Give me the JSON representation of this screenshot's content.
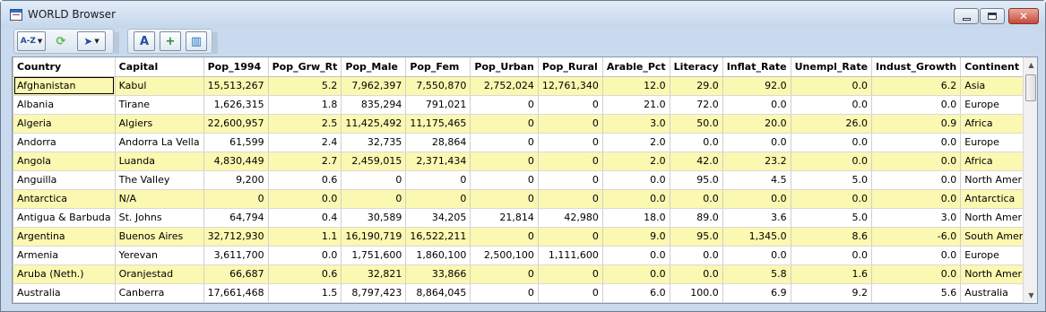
{
  "window": {
    "title": "WORLD Browser",
    "minimize_glyph": "",
    "close_glyph": "✕"
  },
  "toolbar": {
    "filter_icon": "A-Z",
    "refresh_icon": "⟳",
    "pointer_icon": "➤",
    "font_icon": "A",
    "add_icon": "+",
    "columns_icon": "▥",
    "dropdown_arrow": "▼"
  },
  "grid": {
    "columns": [
      "Country",
      "Capital",
      "Pop_1994",
      "Pop_Grw_Rt",
      "Pop_Male",
      "Pop_Fem",
      "Pop_Urban",
      "Pop_Rural",
      "Arable_Pct",
      "Literacy",
      "Inflat_Rate",
      "Unempl_Rate",
      "Indust_Growth",
      "Continent"
    ],
    "rows": [
      [
        "Afghanistan",
        "Kabul",
        "15,513,267",
        "5.2",
        "7,962,397",
        "7,550,870",
        "2,752,024",
        "12,761,340",
        "12.0",
        "29.0",
        "92.0",
        "0.0",
        "6.2",
        "Asia"
      ],
      [
        "Albania",
        "Tirane",
        "1,626,315",
        "1.8",
        "835,294",
        "791,021",
        "0",
        "0",
        "21.0",
        "72.0",
        "0.0",
        "0.0",
        "0.0",
        "Europe"
      ],
      [
        "Algeria",
        "Algiers",
        "22,600,957",
        "2.5",
        "11,425,492",
        "11,175,465",
        "0",
        "0",
        "3.0",
        "50.0",
        "20.0",
        "26.0",
        "0.9",
        "Africa"
      ],
      [
        "Andorra",
        "Andorra La Vella",
        "61,599",
        "2.4",
        "32,735",
        "28,864",
        "0",
        "0",
        "2.0",
        "0.0",
        "0.0",
        "0.0",
        "0.0",
        "Europe"
      ],
      [
        "Angola",
        "Luanda",
        "4,830,449",
        "2.7",
        "2,459,015",
        "2,371,434",
        "0",
        "0",
        "2.0",
        "42.0",
        "23.2",
        "0.0",
        "0.0",
        "Africa"
      ],
      [
        "Anguilla",
        "The Valley",
        "9,200",
        "0.6",
        "0",
        "0",
        "0",
        "0",
        "0.0",
        "95.0",
        "4.5",
        "5.0",
        "0.0",
        "North America"
      ],
      [
        "Antarctica",
        "N/A",
        "0",
        "0.0",
        "0",
        "0",
        "0",
        "0",
        "0.0",
        "0.0",
        "0.0",
        "0.0",
        "0.0",
        "Antarctica"
      ],
      [
        "Antigua & Barbuda",
        "St. Johns",
        "64,794",
        "0.4",
        "30,589",
        "34,205",
        "21,814",
        "42,980",
        "18.0",
        "89.0",
        "3.6",
        "5.0",
        "3.0",
        "North America"
      ],
      [
        "Argentina",
        "Buenos Aires",
        "32,712,930",
        "1.1",
        "16,190,719",
        "16,522,211",
        "0",
        "0",
        "9.0",
        "95.0",
        "1,345.0",
        "8.6",
        "-6.0",
        "South America"
      ],
      [
        "Armenia",
        "Yerevan",
        "3,611,700",
        "0.0",
        "1,751,600",
        "1,860,100",
        "2,500,100",
        "1,111,600",
        "0.0",
        "0.0",
        "0.0",
        "0.0",
        "0.0",
        "Europe"
      ],
      [
        "Aruba (Neth.)",
        "Oranjestad",
        "66,687",
        "0.6",
        "32,821",
        "33,866",
        "0",
        "0",
        "0.0",
        "0.0",
        "5.8",
        "1.6",
        "0.0",
        "North America"
      ],
      [
        "Australia",
        "Canberra",
        "17,661,468",
        "1.5",
        "8,797,423",
        "8,864,045",
        "0",
        "0",
        "6.0",
        "100.0",
        "6.9",
        "9.2",
        "5.6",
        "Australia"
      ],
      [
        "",
        "",
        "",
        "",
        "",
        "",
        "",
        "",
        "",
        "",
        "",
        "",
        "",
        ""
      ]
    ]
  },
  "scrollbar": {
    "up": "▲",
    "down": "▼"
  }
}
